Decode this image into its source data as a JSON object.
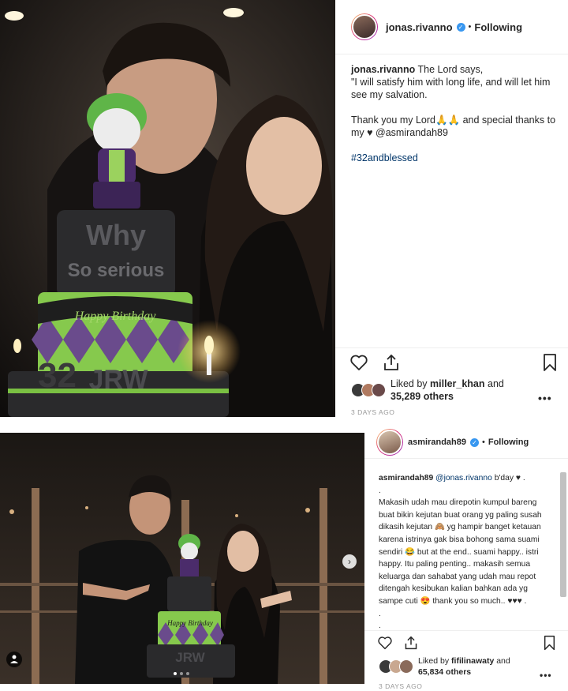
{
  "post1": {
    "username": "jonas.rivanno",
    "follow_label": "Following",
    "caption_user": "jonas.rivanno",
    "caption_lines": [
      "The Lord says,",
      "\"I will satisfy him with long life, and will let him see my salvation.",
      "",
      "Thank you my Lord🙏🙏 and special thanks to my ♥ @asmirandah89",
      "",
      "#32andblessed"
    ],
    "liked_by_prefix": "Liked by",
    "liked_by_user": "miller_khan",
    "liked_by_and": "and",
    "others": "35,289 others",
    "date": "3 DAYS AGO",
    "cake_text_top": "Why",
    "cake_text_mid": "So serious",
    "cake_text_ribbon": "Happy Birthday",
    "cake_text_bottom": "JRW",
    "cake_number": "32"
  },
  "post2": {
    "username": "asmirandah89",
    "follow_label": "Following",
    "comment_user": "asmirandah89",
    "comment_mention": "@jonas.rivanno",
    "comment_lines": [
      "b'day ♥ .",
      ".",
      "Makasih udah mau direpotin kumpul bareng buat bikin kejutan buat orang yg paling susah dikasih kejutan 🙈 yg hampir banget ketauan karena istrinya gak bisa bohong sama suami sendiri 😂 but at the end.. suami happy.. istri happy. Itu paling penting.. makasih semua keluarga dan sahabat yang udah mau repot ditengah kesibukan kalian bahkan ada yg sampe cuti 😍 thank you so much.. ♥♥♥ .",
      ".",
      "."
    ],
    "liked_by_prefix": "Liked by",
    "liked_by_user": "fifilinawaty",
    "liked_by_and": "and",
    "others": "65,834 others",
    "date": "3 DAYS AGO",
    "cake_text_ribbon": "Happy Birthday",
    "cake_text_bottom": "JRW"
  },
  "colors": {
    "accent": "#3897f0",
    "cake_green": "#8fd14f",
    "cake_purple": "#6b4a8a",
    "cake_black": "#2a2a2a"
  }
}
